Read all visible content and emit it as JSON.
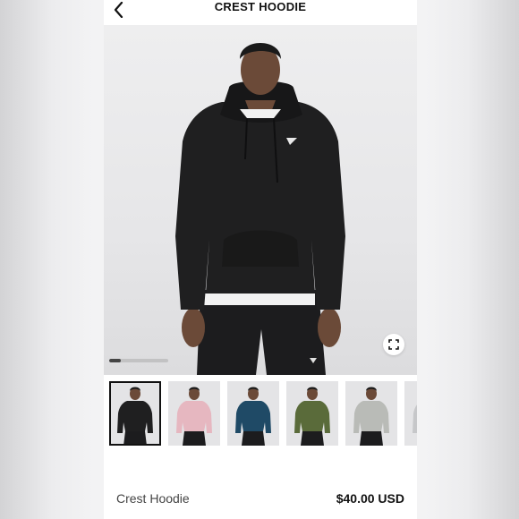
{
  "header": {
    "title": "CREST HOODIE",
    "back_icon": "chevron-left-icon"
  },
  "hero": {
    "expand_icon": "fullscreen-icon",
    "gallery_progress": 0.2
  },
  "thumbnails": [
    {
      "color_name": "black",
      "color": "#1f1f20"
    },
    {
      "color_name": "pink",
      "color": "#e6b7c0"
    },
    {
      "color_name": "blue",
      "color": "#1f4a66"
    },
    {
      "color_name": "green",
      "color": "#5a6b3a"
    },
    {
      "color_name": "grey",
      "color": "#b9bbb7"
    },
    {
      "color_name": "light-grey",
      "color": "#c6c7c9"
    }
  ],
  "product": {
    "name": "Crest Hoodie",
    "price": "$40.00 USD"
  }
}
